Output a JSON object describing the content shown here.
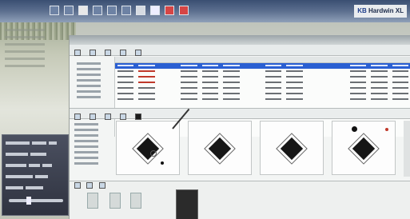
{
  "brand": {
    "logo_text_a": "KB",
    "logo_text_b": "Hardwin XL"
  },
  "window": {
    "toolbar1": [
      "",
      "",
      "",
      "",
      ""
    ],
    "table": {
      "headers": [
        "",
        "",
        "",
        "",
        "",
        "",
        "",
        "",
        "",
        "",
        "",
        "",
        "",
        ""
      ],
      "rows": 7
    },
    "toolbar2": [
      "",
      "",
      "",
      "",
      ""
    ],
    "spots": [
      "",
      "",
      "",
      ""
    ]
  }
}
